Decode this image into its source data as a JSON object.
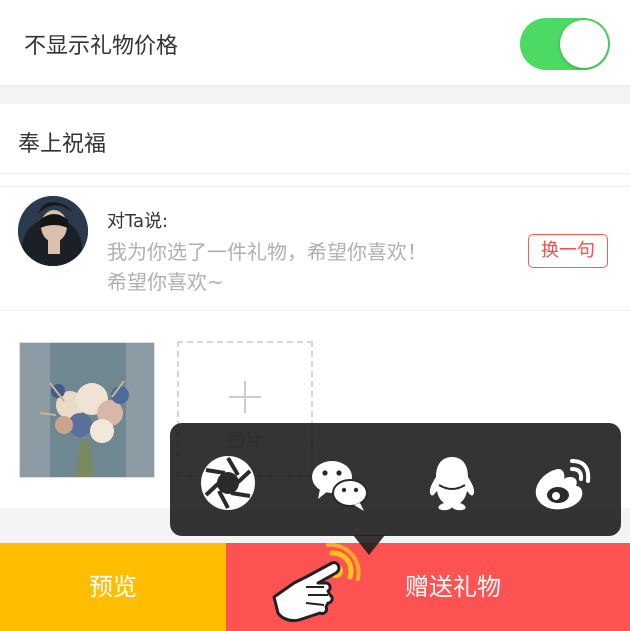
{
  "settings": {
    "hide_price_label": "不显示礼物价格",
    "hide_price_on": true
  },
  "blessing": {
    "section_title": "奉上祝福",
    "to_label": "对Ta说:",
    "message_line1": "我为你选了一件礼物，希望你喜欢！",
    "message_line2": "希望你喜欢~",
    "swap_label": "换一句"
  },
  "photos": {
    "add_label": "图片"
  },
  "share": {
    "icons": [
      "moments-icon",
      "wechat-icon",
      "qq-icon",
      "weibo-icon"
    ]
  },
  "actions": {
    "preview_label": "预览",
    "send_label": "赠送礼物"
  },
  "colors": {
    "toggle_on": "#4cd964",
    "preview": "#ffbf00",
    "send": "#ff5252",
    "accent_red": "#ff4a4a"
  }
}
